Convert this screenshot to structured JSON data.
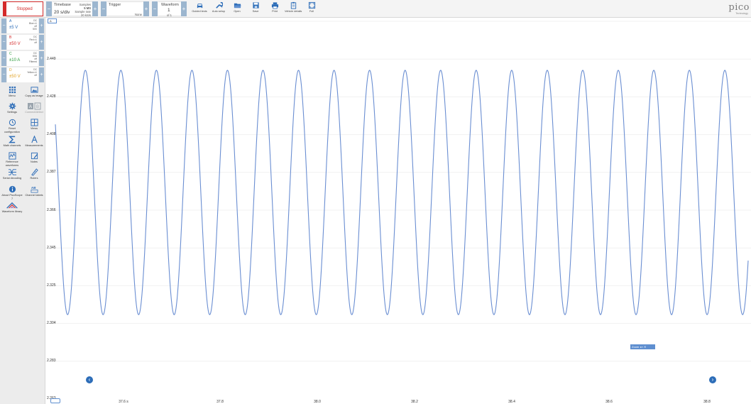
{
  "colors": {
    "accent": "#2d6db8",
    "stop": "#d42a2a",
    "trace": "#6a8ed2",
    "chA": "#2d6db8",
    "chB": "#d42a2a",
    "chC": "#2a9a3a",
    "chD": "#e0a020"
  },
  "toolbar": {
    "status": "Stopped",
    "timebase_title": "Timebase",
    "timebase_value": "20 s/div",
    "samples_title": "Samples",
    "samples_value": "5 MS",
    "sample_rate_title": "Sample rate",
    "sample_rate_value": "20 kS/s",
    "trigger_title": "Trigger",
    "trigger_value": "None",
    "waveform_title": "Waveform",
    "waveform_value": "1",
    "waveform_of": "of 1",
    "tools": [
      {
        "label": "Guided tests",
        "icon": "car-icon"
      },
      {
        "label": "Auto setup",
        "icon": "wrench-icon"
      },
      {
        "label": "Open",
        "icon": "folder-icon"
      },
      {
        "label": "Save",
        "icon": "save-icon"
      },
      {
        "label": "Print",
        "icon": "printer-icon"
      },
      {
        "label": "Vehicle details",
        "icon": "clipboard-icon"
      },
      {
        "label": "Full",
        "icon": "fullscreen-icon"
      }
    ],
    "logo": "pico",
    "logo_sub": "Technology"
  },
  "channels": [
    {
      "letter": "A",
      "range": "±5 V",
      "info1": "DC",
      "info2": "Blue x1",
      "info3": "off",
      "info4": "50X"
    },
    {
      "letter": "B",
      "range": "±50 V",
      "info1": "DC",
      "info2": "Red x1",
      "info3": "off",
      "info4": ""
    },
    {
      "letter": "C",
      "range": "±10 A",
      "info1": "DC",
      "info2": "60A",
      "info3": "off",
      "info4": "Filtered"
    },
    {
      "letter": "D",
      "range": "±50 V",
      "info1": "DC",
      "info2": "Yellow x1",
      "info3": "off",
      "info4": ""
    }
  ],
  "left_tools": [
    {
      "label": "Menu",
      "icon": "grid-menu-icon"
    },
    {
      "label": "Copy as image",
      "icon": "image-icon"
    },
    {
      "label": "Settings",
      "icon": "gear-icon"
    },
    {
      "label": "Connect/detect",
      "icon": "connect-icon"
    },
    {
      "label": "Reset configuration",
      "icon": "reset-icon"
    },
    {
      "label": "Views",
      "icon": "views-icon"
    },
    {
      "label": "Math channels",
      "icon": "sigma-icon"
    },
    {
      "label": "Measurements",
      "icon": "measure-icon"
    },
    {
      "label": "Reference waveforms",
      "icon": "reference-icon"
    },
    {
      "label": "Notes",
      "icon": "notes-icon"
    },
    {
      "label": "Serial decoding",
      "icon": "serial-icon"
    },
    {
      "label": "Rulers",
      "icon": "ruler-icon"
    },
    {
      "label": "About PicoScope 7",
      "icon": "info-icon"
    },
    {
      "label": "Channel labels",
      "icon": "channel-labels-icon"
    },
    {
      "label": "Waveform library",
      "icon": "library-icon"
    }
  ],
  "scope": {
    "channel_indicator": "A",
    "zoom_label": "Zoom",
    "y_ticks": [
      "2.449",
      "2.428",
      "2.408",
      "2.387",
      "2.366",
      "2.345",
      "2.325",
      "2.304",
      "2.283",
      "2.263"
    ],
    "x_ticks": [
      "37.6 s",
      "37.8",
      "38.0",
      "38.2",
      "38.4",
      "38.6",
      "38.8"
    ]
  },
  "chart_data": {
    "type": "line",
    "x_range": [
      37.45,
      38.86
    ],
    "ylim": [
      2.263,
      2.47
    ],
    "series": [
      {
        "channel": "A",
        "shape": "periodic",
        "peak": 2.449,
        "trough": 2.3125,
        "cycles": 19.5,
        "phase": 2.55
      }
    ]
  }
}
